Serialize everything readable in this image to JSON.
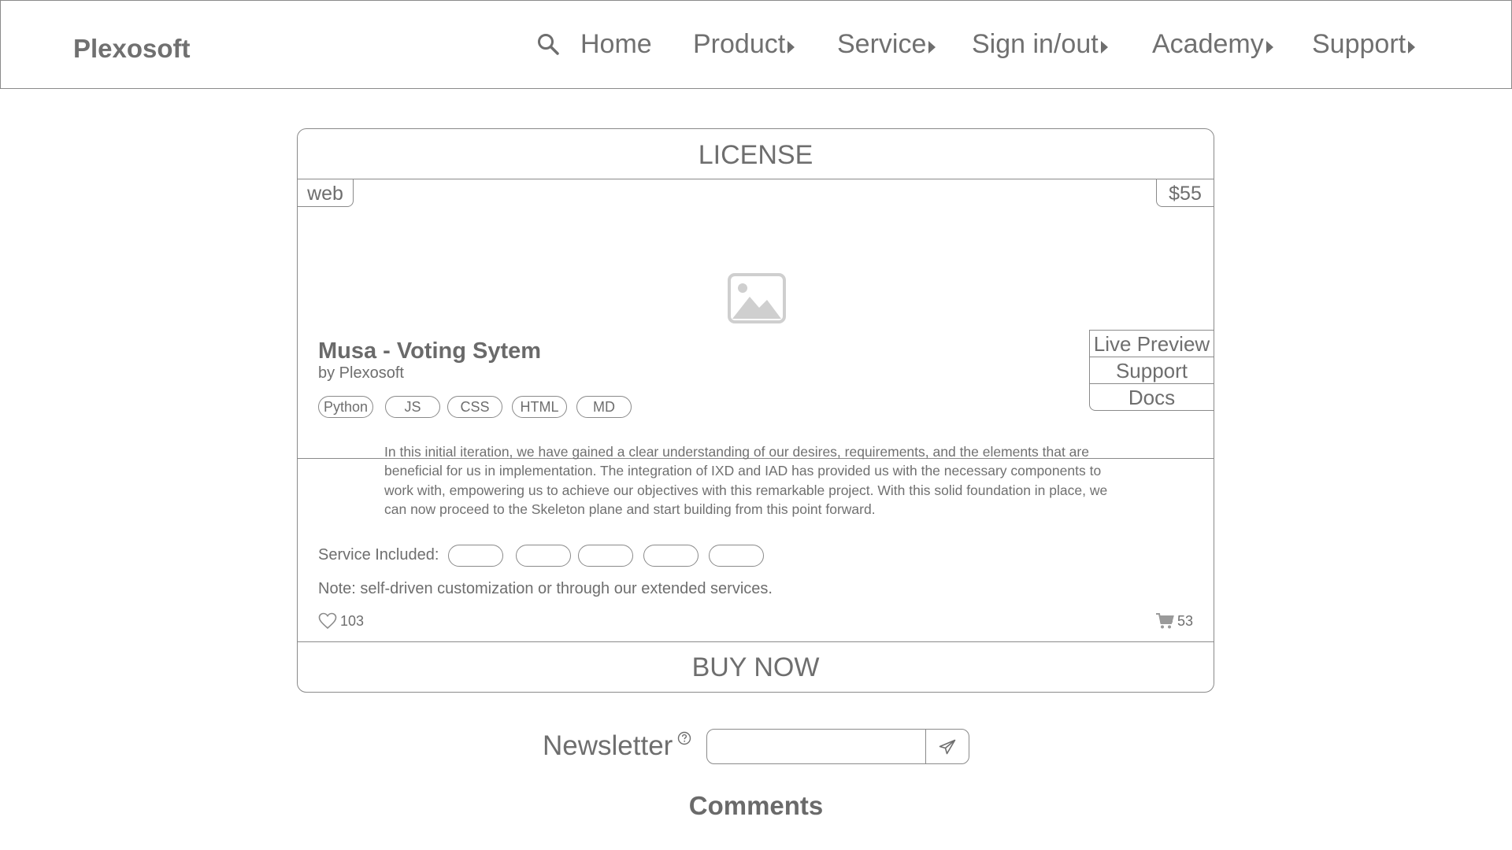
{
  "header": {
    "logo": "Plexosoft",
    "search_icon": "search-icon",
    "nav": [
      {
        "label": "Home",
        "has_caret": false
      },
      {
        "label": "Product",
        "has_caret": true
      },
      {
        "label": "Service",
        "has_caret": true
      },
      {
        "label": "Sign in/out",
        "has_caret": true
      },
      {
        "label": "Academy",
        "has_caret": true
      },
      {
        "label": "Support",
        "has_caret": true
      }
    ]
  },
  "card": {
    "title": "LICENSE",
    "platform_tag": "web",
    "price": "$55",
    "image_icon": "image-placeholder-icon",
    "product_name": "Musa - Voting Sytem",
    "author": "by Plexosoft",
    "side_links": [
      "Live Preview",
      "Support",
      "Docs"
    ],
    "tech_tags": [
      "Python",
      "JS",
      "CSS",
      "HTML",
      "MD"
    ],
    "description": "In this initial iteration, we have gained a clear understanding of our desires, requirements, and the elements that are beneficial for us in implementation. The integration of IXD and IAD has provided us with the necessary components to work with, empowering us to achieve our objectives with this remarkable project. With this solid foundation in place, we can now proceed to the Skeleton plane and start building from this point forward.",
    "service_label": "Service Included:",
    "service_pill_count": 5,
    "note": "Note: self-driven customization or through our extended services.",
    "likes": "103",
    "cart_count": "53",
    "buy_label": "BUY NOW"
  },
  "newsletter": {
    "label": "Newsletter",
    "help_icon": "question-circle-icon",
    "input_value": "",
    "send_icon": "send-icon"
  },
  "comments": {
    "title": "Comments"
  },
  "colors": {
    "stroke": "#8a8a8a",
    "text": "#6e6e6e",
    "placeholder": "#cfcfcf"
  }
}
